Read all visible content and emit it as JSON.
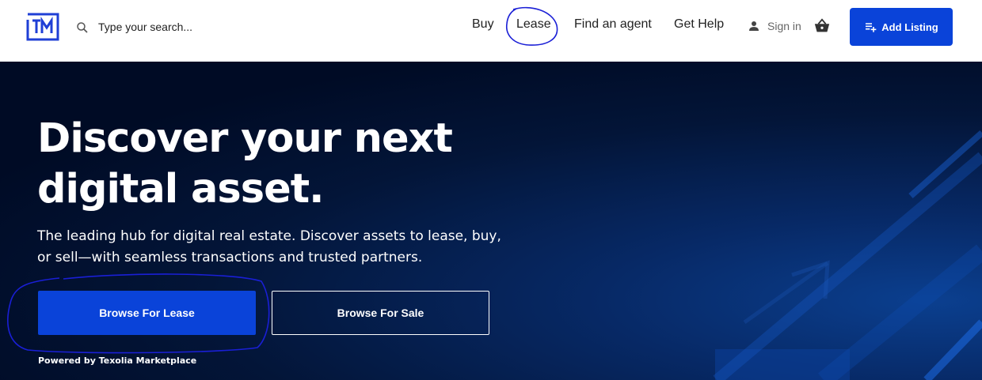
{
  "header": {
    "logo_text": "TM",
    "search": {
      "placeholder": "Type your search..."
    },
    "nav": [
      "Buy",
      "Lease",
      "Find an agent",
      "Get Help"
    ],
    "sign_in_label": "Sign in",
    "add_listing_label": "Add Listing"
  },
  "hero": {
    "title_line1": "Discover your next",
    "title_line2": "digital asset.",
    "subtitle": "The leading hub for digital real estate. Discover assets to lease, buy, or sell—with seamless transactions and trusted partners.",
    "browse_lease_label": "Browse For Lease",
    "browse_sale_label": "Browse For Sale",
    "powered_by": "Powered by Texolia Marketplace"
  },
  "colors": {
    "brand_blue": "#0a43d9",
    "hero_background": "#000b25",
    "annotation_ink": "#1a1fd6"
  },
  "icons": [
    "logo-icon",
    "search-icon",
    "person-icon",
    "cart-icon",
    "playlist-add-icon"
  ]
}
